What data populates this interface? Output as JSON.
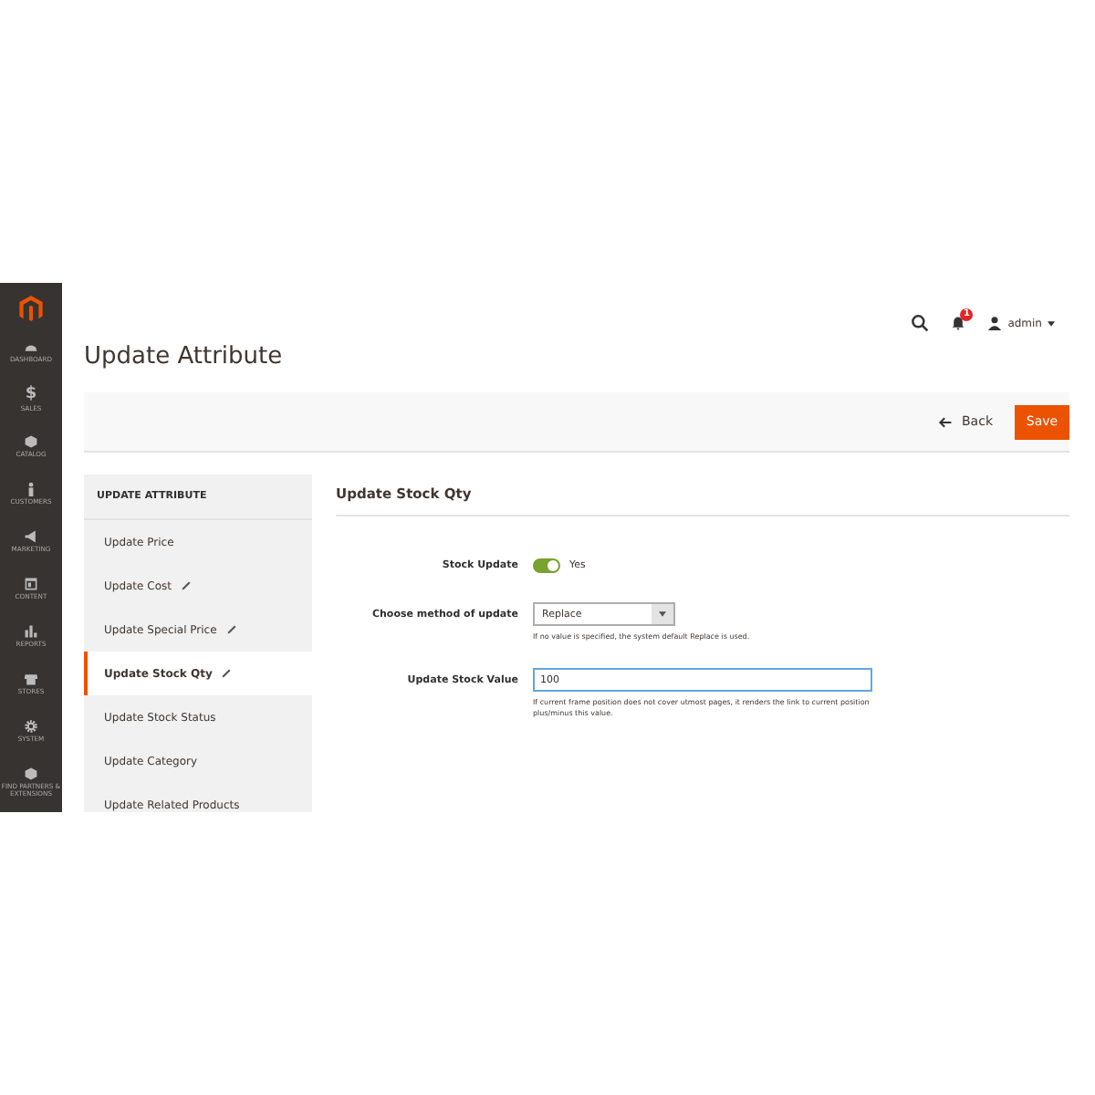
{
  "sidebar": {
    "items": [
      {
        "label": "DASHBOARD",
        "kind": "dashboard"
      },
      {
        "label": "$",
        "kind": "glyph",
        "sub": "SALES"
      },
      {
        "label": "CATALOG",
        "kind": "box"
      },
      {
        "label": "CUSTOMERS",
        "kind": "person"
      },
      {
        "label": "MARKETING",
        "kind": "megaphone"
      },
      {
        "label": "CONTENT",
        "kind": "layout"
      },
      {
        "label": "REPORTS",
        "kind": "bars"
      },
      {
        "label": "STORES",
        "kind": "store"
      },
      {
        "label": "SYSTEM",
        "kind": "gear"
      },
      {
        "label": "FIND PARTNERS & EXTENSIONS",
        "kind": "box"
      }
    ]
  },
  "header": {
    "title": "Update Attribute",
    "notifications": "1",
    "user": "admin"
  },
  "actions": {
    "back": "Back",
    "save": "Save"
  },
  "nav": {
    "title": "UPDATE ATTRIBUTE",
    "items": [
      {
        "label": "Update Price",
        "edited": false,
        "selected": false
      },
      {
        "label": "Update Cost",
        "edited": true,
        "selected": false
      },
      {
        "label": "Update Special Price",
        "edited": true,
        "selected": false
      },
      {
        "label": "Update Stock Qty",
        "edited": true,
        "selected": true
      },
      {
        "label": "Update Stock Status",
        "edited": false,
        "selected": false
      },
      {
        "label": "Update Category",
        "edited": false,
        "selected": false
      },
      {
        "label": "Update Related Products",
        "edited": false,
        "selected": false
      }
    ]
  },
  "form": {
    "title": "Update Stock Qty",
    "fields": [
      {
        "kind": "toggle",
        "label": "Stock Update",
        "on": true,
        "text": "Yes"
      },
      {
        "kind": "select",
        "label": "Choose method of update",
        "value": "Replace",
        "note": "If no value is specified, the system default Replace is used."
      },
      {
        "kind": "input",
        "label": "Update Stock Value",
        "value": "100",
        "note": "If current frame position does not cover utmost pages, it renders the link to current position plus/minus this value."
      }
    ]
  }
}
